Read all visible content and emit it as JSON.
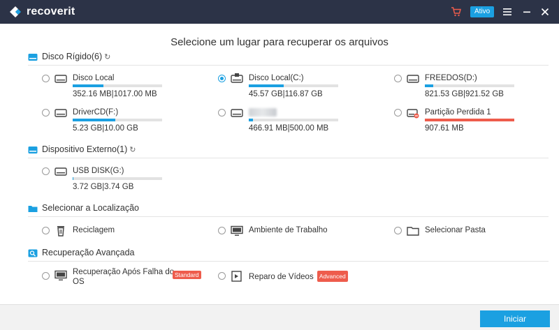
{
  "app": {
    "name": "recoverit",
    "status_badge": "Ativo"
  },
  "colors": {
    "titlebar": "#2c3347",
    "accent": "#1ba0e1",
    "danger": "#ee5c4c"
  },
  "heading": "Selecione um lugar para recuperar os arquivos",
  "sections": {
    "hard_disk": {
      "label": "Disco Rígido(6)",
      "icon": "hard-disk-icon",
      "refresh": "↻"
    },
    "external": {
      "label": "Dispositivo Externo(1)",
      "icon": "external-device-icon",
      "refresh": "↻"
    },
    "location": {
      "label": "Selecionar a Localização",
      "icon": "folder-icon"
    },
    "advanced": {
      "label": "Recuperação Avançada",
      "icon": "advanced-search-icon"
    }
  },
  "drives": [
    {
      "name": "Disco Local",
      "size": "352.16  MB|1017.00  MB",
      "used_fraction": 0.346,
      "selected": false
    },
    {
      "name": "Disco Local(C:)",
      "size": "45.57  GB|116.87  GB",
      "used_fraction": 0.39,
      "selected": true
    },
    {
      "name": "FREEDOS(D:)",
      "size": "821.53  GB|921.52  GB",
      "used_fraction": 0.09,
      "selected": false
    },
    {
      "name": "DriverCD(F:)",
      "size": "5.23  GB|10.00  GB",
      "used_fraction": 0.48,
      "selected": false
    },
    {
      "name": "",
      "size": "466.91  MB|500.00  MB",
      "used_fraction": 0.05,
      "selected": false
    },
    {
      "name": "Partição Perdida 1",
      "size": "907.61  MB",
      "used_fraction": 1.0,
      "selected": false
    }
  ],
  "external_drives": [
    {
      "name": "USB DISK(G:)",
      "size": "3.72  GB|3.74  GB",
      "used_fraction": 0.005,
      "selected": false
    }
  ],
  "locations": [
    {
      "label": "Reciclagem",
      "icon": "recycle-bin-icon"
    },
    {
      "label": "Ambiente de Trabalho",
      "icon": "desktop-icon"
    },
    {
      "label": "Selecionar Pasta",
      "icon": "folder-open-icon"
    }
  ],
  "advanced_items": [
    {
      "label": "Recuperação Após Falha do OS",
      "badge": "Standard",
      "icon": "crash-recovery-icon"
    },
    {
      "label": "Reparo de Vídeos",
      "badge": "Advanced",
      "icon": "video-repair-icon"
    }
  ],
  "footer": {
    "start_label": "Iniciar"
  }
}
